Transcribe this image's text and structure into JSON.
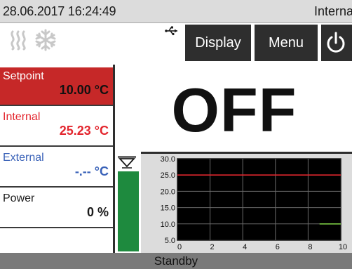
{
  "status_bar": {
    "datetime": "28.06.2017 16:24:49",
    "mode": "Interna"
  },
  "toolbar": {
    "display_label": "Display",
    "menu_label": "Menu",
    "icons": [
      "heating-icon",
      "cooling-icon",
      "usb-icon",
      "power-icon"
    ]
  },
  "parameters": {
    "setpoint": {
      "label": "Setpoint",
      "value": "10.00 °C"
    },
    "internal": {
      "label": "Internal",
      "value": "25.23 °C"
    },
    "external": {
      "label": "External",
      "value": "-.-- °C"
    },
    "power": {
      "label": "Power",
      "value": "0 %"
    }
  },
  "main_status": "OFF",
  "level_fraction": 1.0,
  "footer": {
    "status": "Standby"
  },
  "colors": {
    "setpoint_bg": "#c62828",
    "internal_text": "#e3262e",
    "external_text": "#3a62b8",
    "level_bar": "#1e8a3e",
    "setpoint_line": "#e3262e",
    "internal_line": "#7ac943"
  },
  "chart_data": {
    "type": "line",
    "xlim": [
      0,
      10
    ],
    "ylim": [
      5.0,
      30.0
    ],
    "x_ticks": [
      "0",
      "2",
      "4",
      "6",
      "8",
      "10"
    ],
    "y_ticks": [
      "5.0",
      "10.0",
      "15.0",
      "20.0",
      "25.0",
      "30.0"
    ],
    "grid": true,
    "series": [
      {
        "color": "#e3262e",
        "x": [
          0,
          10
        ],
        "y": [
          25.0,
          25.0
        ]
      },
      {
        "color": "#7ac943",
        "x": [
          8.7,
          10
        ],
        "y": [
          10.0,
          10.0
        ]
      }
    ]
  }
}
